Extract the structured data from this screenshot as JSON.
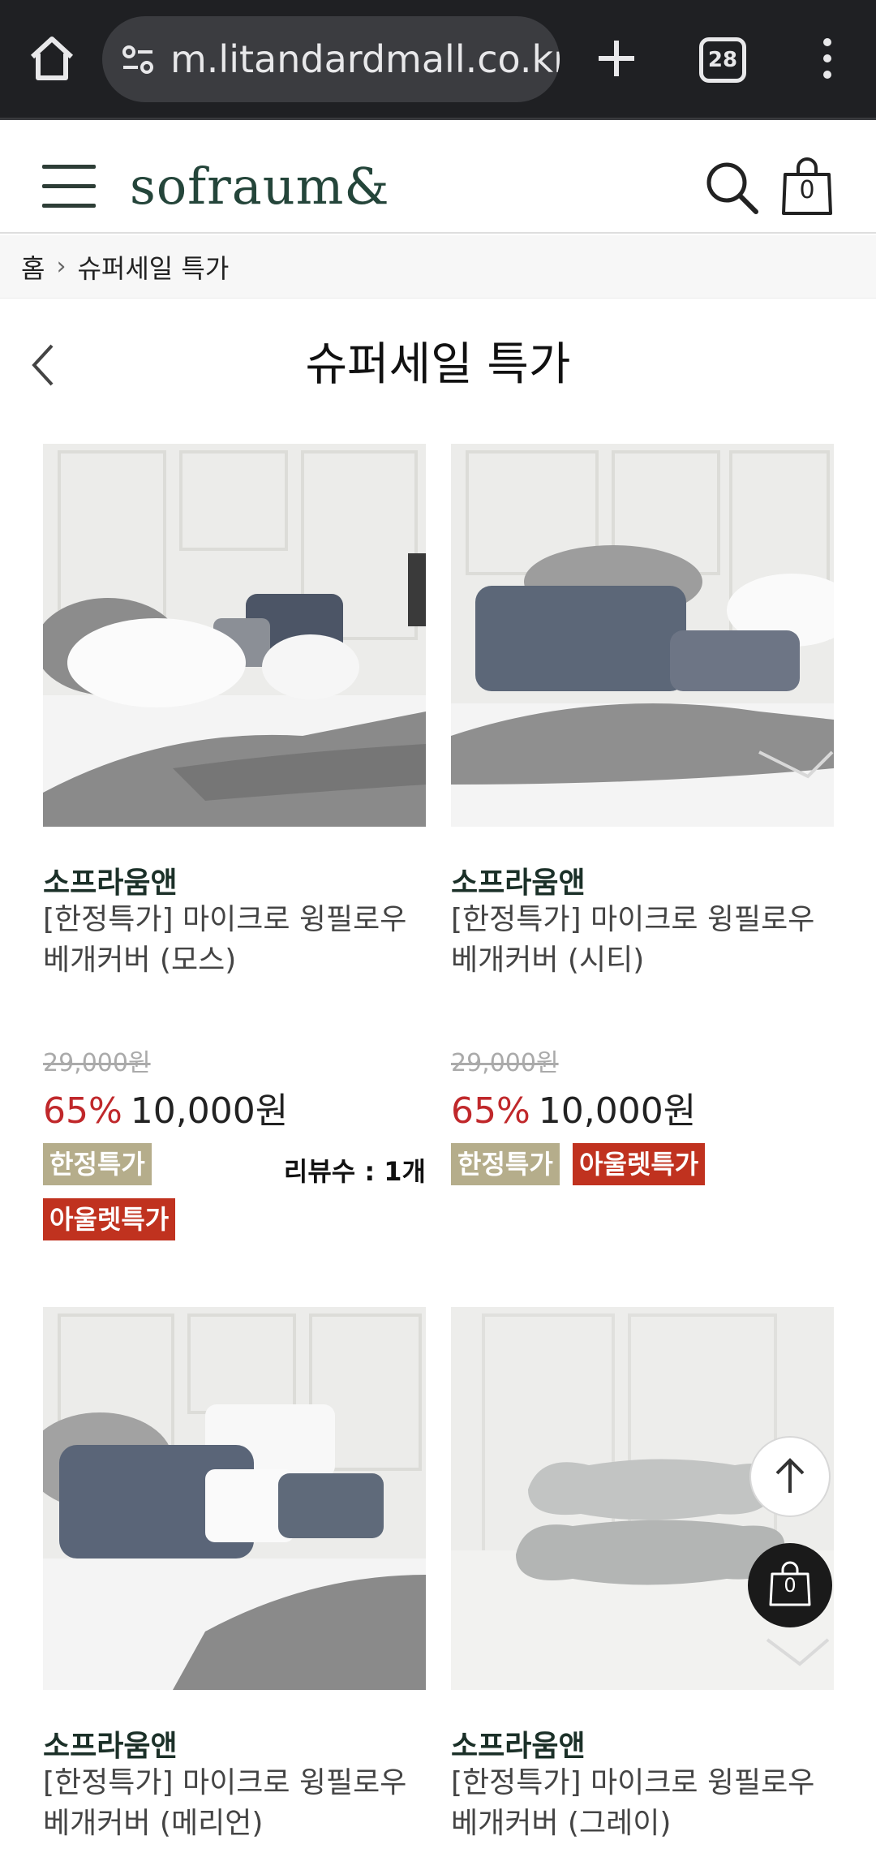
{
  "browser": {
    "url": "m.litandardmall.co.kr/",
    "tab_count": "28"
  },
  "header": {
    "logo": "sofraum&",
    "cart_count": "0"
  },
  "breadcrumb": {
    "home": "홈",
    "current": "슈퍼세일 특가"
  },
  "page": {
    "title": "슈퍼세일 특가"
  },
  "products": [
    {
      "brand": "소프라움앤",
      "name": "[한정특가] 마이크로 윙필로우 베개커버 (모스)",
      "original_price": "29,000원",
      "discount": "65%",
      "price": "10,000원",
      "tags": [
        "한정특가",
        "아울렛특가"
      ],
      "reviews": "리뷰수 : 1개"
    },
    {
      "brand": "소프라움앤",
      "name": "[한정특가] 마이크로 윙필로우 베개커버 (시티)",
      "original_price": "29,000원",
      "discount": "65%",
      "price": "10,000원",
      "tags": [
        "한정특가",
        "아울렛특가"
      ],
      "reviews": ""
    },
    {
      "brand": "소프라움앤",
      "name": "[한정특가] 마이크로 윙필로우 베개커버 (메리언)"
    },
    {
      "brand": "소프라움앤",
      "name": "[한정특가] 마이크로 윙필로우 베개커버 (그레이)"
    }
  ],
  "floating": {
    "cart_count": "0"
  },
  "colors": {
    "brand_green": "#24453a",
    "discount_red": "#c0282b",
    "tag_limited": "#b5ad8b",
    "tag_outlet": "#c0321f",
    "browser_bg": "#1f2023"
  }
}
